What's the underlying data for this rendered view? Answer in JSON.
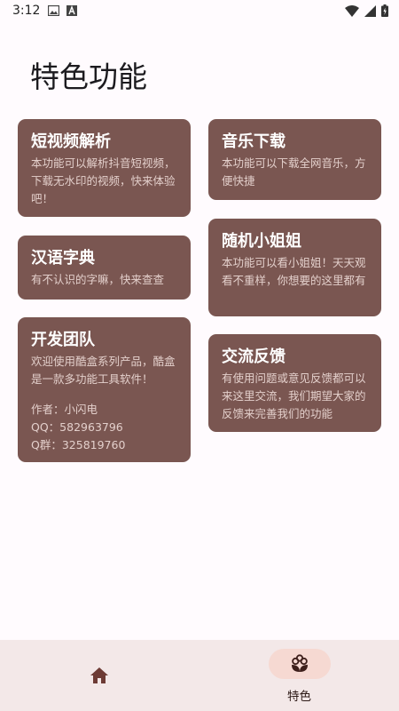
{
  "status": {
    "time": "3:12",
    "left_icons": [
      "image-icon",
      "a-notification-icon"
    ],
    "right_icons": [
      "wifi-icon",
      "signal-icon",
      "battery-icon"
    ]
  },
  "page": {
    "title": "特色功能"
  },
  "colors": {
    "card": "#7a5651",
    "background": "#fffbfe",
    "nav_bg": "#f3e8e8",
    "nav_pill": "#f6d9d2"
  },
  "cards": {
    "video": {
      "title": "短视频解析",
      "desc": "本功能可以解析抖音短视频，下载无水印的视频，快来体验吧！"
    },
    "dict": {
      "title": "汉语字典",
      "desc": "有不认识的字嘛，快来查查"
    },
    "team": {
      "title": "开发团队",
      "desc": "欢迎使用酷盒系列产品，酷盒是一款多功能工具软件！",
      "author": "作者：小闪电",
      "qq": "QQ：582963796",
      "qq_group": "Q群：325819760"
    },
    "music": {
      "title": "音乐下载",
      "desc": "本功能可以下载全网音乐，方便快捷"
    },
    "girl": {
      "title": "随机小姐姐",
      "desc": "本功能可以看小姐姐！天天观看不重样，你想要的这里都有"
    },
    "feedback": {
      "title": "交流反馈",
      "desc": "有使用问题或意见反馈都可以来这里交流，我们期望大家的反馈来完善我们的功能"
    }
  },
  "nav": {
    "home_icon": "home-icon",
    "feature_icon": "flower-icon",
    "feature_label": "特色"
  }
}
